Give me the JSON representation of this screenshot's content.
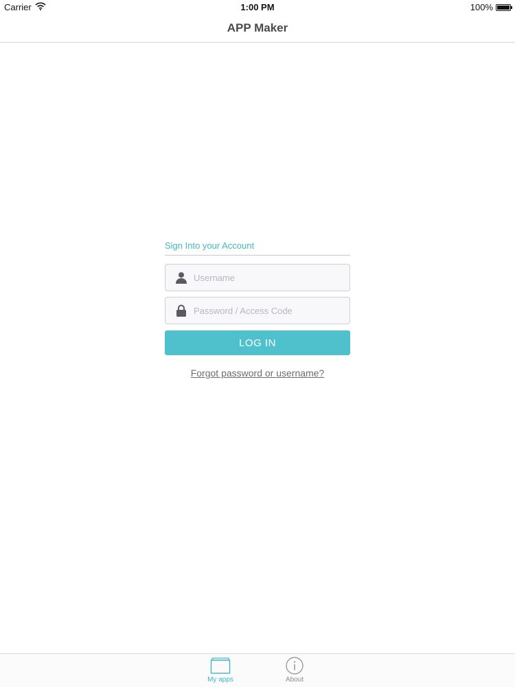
{
  "status_bar": {
    "carrier": "Carrier",
    "time": "1:00 PM",
    "battery": "100%",
    "battery_level": 1.0
  },
  "nav": {
    "title": "APP Maker"
  },
  "login": {
    "heading": "Sign Into your Account",
    "username_placeholder": "Username",
    "password_placeholder": "Password / Access Code",
    "login_label": "LOG IN",
    "forgot_label": "Forgot password or username?"
  },
  "tabs": [
    {
      "label": "My apps",
      "icon": "folder-icon",
      "selected": true
    },
    {
      "label": "About",
      "icon": "info-icon",
      "selected": false
    }
  ],
  "colors": {
    "accent": "#3fb8c6",
    "button": "#4fc1cc",
    "tab_inactive": "#8e8e93"
  }
}
